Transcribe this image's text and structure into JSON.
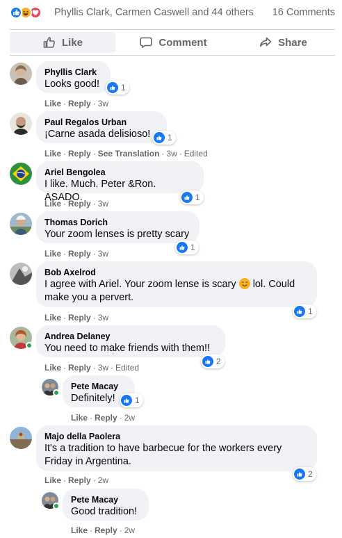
{
  "summary": {
    "reactors": "Phyllis Clark, Carmen Caswell and 44 others",
    "comment_count": "16 Comments",
    "reaction_icons": [
      "like-icon",
      "haha-icon",
      "love-icon"
    ],
    "colors": {
      "like": "#1877f2",
      "haha": "#f7b125",
      "love": "#f33e58"
    }
  },
  "actions": {
    "like_label": "Like",
    "comment_label": "Comment",
    "share_label": "Share"
  },
  "ui": {
    "like": "Like",
    "reply": "Reply",
    "see_translation": "See Translation",
    "separator": "·",
    "edited": "Edited"
  },
  "comments": [
    {
      "author": "Phyllis Clark",
      "text": "Looks good!",
      "reactions": "1",
      "time": "3w"
    },
    {
      "author": "Paul Regalos Urban",
      "text": "¡Carne asada delisioso!",
      "reactions": "1",
      "time": "3w",
      "edited": "Edited"
    },
    {
      "author": "Ariel Bengolea",
      "text": "I like. Much. Peter &Ron. ASADO.",
      "reactions": "1",
      "time": "3w"
    },
    {
      "author": "Thomas Dorich",
      "text": "Your zoom lenses is pretty scary",
      "reactions": "1",
      "time": "3w"
    },
    {
      "author": "Bob Axelrod",
      "text_a": "I agree with Ariel. Your zoom lense is scary",
      "text_b": "lol. Could",
      "text_c": "make you a pervert.",
      "reactions": "1",
      "time": "3w"
    },
    {
      "author": "Andrea Delaney",
      "text": "You need to make friends with them!!",
      "reactions": "2",
      "time": "3w",
      "edited": "Edited"
    },
    {
      "author": "Pete Macay",
      "text": "Definitely!",
      "reactions": "1",
      "time": "2w"
    },
    {
      "author": "Majo della Paolera",
      "text_a": "It's a tradition to have barbecue for the workers every",
      "text_b": "Friday in Argentina.",
      "reactions": "2",
      "time": "2w"
    },
    {
      "author": "Pete Macay",
      "text": "Good tradition!",
      "time": "2w"
    }
  ]
}
